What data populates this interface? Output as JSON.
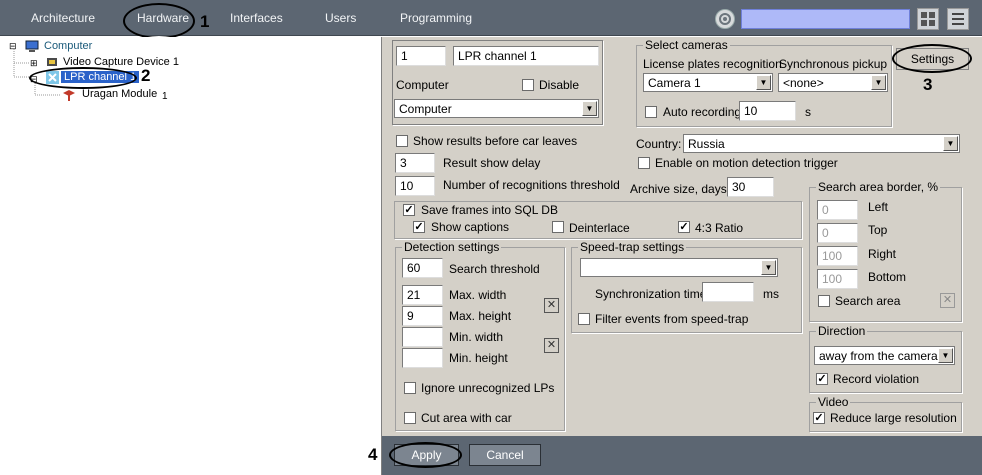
{
  "topbar": {
    "tabs": [
      "Architecture",
      "Hardware",
      "Interfaces",
      "Users",
      "Programming"
    ],
    "search_value": ""
  },
  "callouts": [
    "1",
    "2",
    "3",
    "4"
  ],
  "tree": {
    "root": "Computer",
    "video_device": "Video Capture Device 1",
    "lpr_channel": "LPR channel 1",
    "uragan": "Uragan Module",
    "uragan_index": "1"
  },
  "general": {
    "id": "1",
    "name": "LPR channel 1",
    "computer_label": "Computer",
    "disable_label": "Disable",
    "computer_value": "Computer"
  },
  "select_cameras": {
    "title": "Select cameras",
    "lpr_label": "License plates recognition",
    "sync_label": "Synchronous pickup",
    "camera_value": "Camera 1",
    "sync_value": "<none>",
    "auto_recording_label": "Auto recording",
    "auto_recording_value": "10",
    "unit": "s"
  },
  "settings_label": "Settings",
  "results": {
    "show_results_label": "Show results before car leaves",
    "delay_value": "3",
    "delay_label": "Result show delay",
    "threshold_value": "10",
    "threshold_label": "Number of recognitions threshold"
  },
  "country": {
    "label": "Country:",
    "value": "Russia",
    "motion_label": "Enable on motion detection trigger",
    "archive_label": "Archive size, days:",
    "archive_value": "30"
  },
  "sql": {
    "save_frames_label": "Save frames into SQL DB",
    "show_captions_label": "Show captions",
    "deinterlace_label": "Deinterlace",
    "ratio_label": "4:3 Ratio"
  },
  "detection": {
    "title": "Detection settings",
    "search_threshold_value": "60",
    "search_threshold_label": "Search threshold",
    "max_width_value": "21",
    "max_width_label": "Max. width",
    "max_height_value": "9",
    "max_height_label": "Max. height",
    "min_width_value": "",
    "min_width_label": "Min. width",
    "min_height_value": "",
    "min_height_label": "Min. height",
    "ignore_label": "Ignore unrecognized LPs",
    "cut_label": "Cut area with car"
  },
  "speedtrap": {
    "title": "Speed-trap settings",
    "select_value": "",
    "sync_time_label": "Synchronization time",
    "sync_time_value": "",
    "unit": "ms",
    "filter_label": "Filter events from speed-trap"
  },
  "search_area": {
    "title": "Search area border, %",
    "left_value": "0",
    "left_label": "Left",
    "top_value": "0",
    "top_label": "Top",
    "right_value": "100",
    "right_label": "Right",
    "bottom_value": "100",
    "bottom_label": "Bottom",
    "search_area_label": "Search area"
  },
  "direction": {
    "title": "Direction",
    "value": "away from the camera",
    "record_label": "Record violation"
  },
  "video": {
    "title": "Video",
    "reduce_label": "Reduce large resolution"
  },
  "buttons": {
    "apply": "Apply",
    "cancel": "Cancel"
  }
}
